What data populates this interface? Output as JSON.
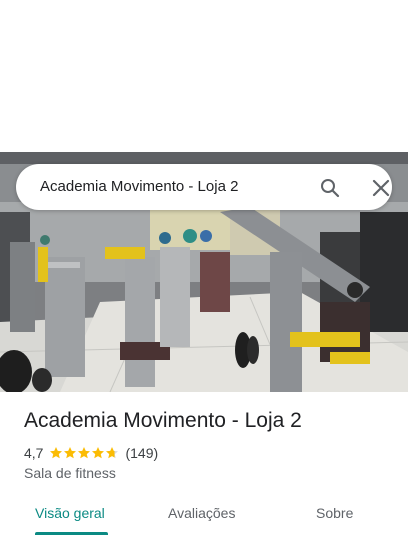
{
  "search": {
    "query": "Academia Movimento - Loja 2",
    "search_icon": "search-icon",
    "close_icon": "close-icon"
  },
  "place": {
    "name": "Academia Movimento - Loja 2",
    "rating": "4,7",
    "rating_value": 4.7,
    "rating_max": 5,
    "review_count": "(149)",
    "category": "Sala de fitness"
  },
  "tabs": [
    {
      "label": "Visão geral",
      "active": true
    },
    {
      "label": "Avaliações",
      "active": false
    },
    {
      "label": "Sobre",
      "active": false
    }
  ],
  "colors": {
    "accent": "#0b8a83",
    "star": "#fbbc04"
  }
}
